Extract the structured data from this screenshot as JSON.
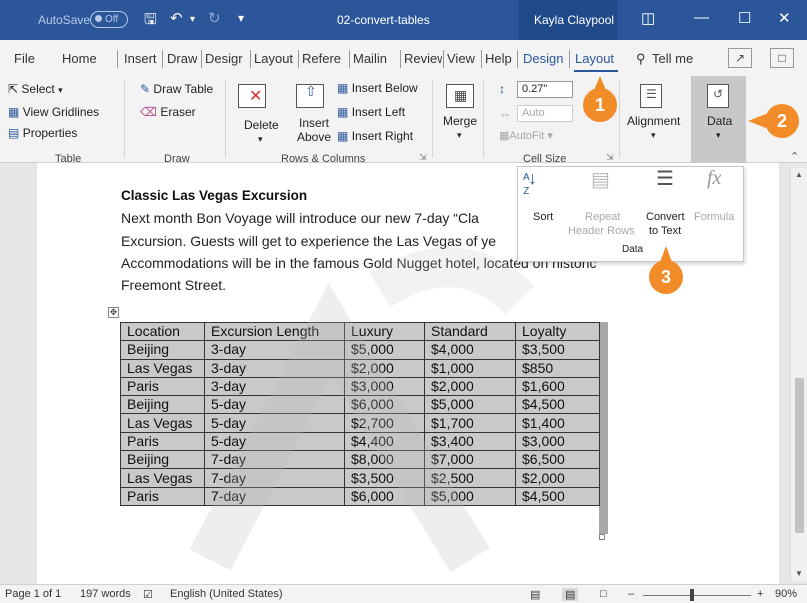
{
  "titlebar": {
    "autosave_label": "AutoSave",
    "autosave_state": "Off",
    "document_title": "02-convert-tables",
    "user_name": "Kayla Claypool",
    "controls": [
      "ribbon-display-icon",
      "minimize-icon",
      "maximize-icon",
      "close-icon"
    ]
  },
  "tabs": {
    "items": [
      "File",
      "Home",
      "Insert",
      "Draw",
      "Desigr",
      "Layout",
      "Refere",
      "Mailin",
      "Review",
      "View",
      "Help",
      "Design",
      "Layout"
    ],
    "tell_me": "Tell me"
  },
  "ribbon": {
    "table_group": {
      "label": "Table",
      "select": "Select",
      "view_gridlines": "View Gridlines",
      "properties": "Properties"
    },
    "draw_group": {
      "label": "Draw",
      "draw_table": "Draw Table",
      "eraser": "Eraser"
    },
    "rows_cols_group": {
      "label": "Rows & Columns",
      "delete": "Delete",
      "insert_above_1": "Insert",
      "insert_above_2": "Above",
      "insert_below": "Insert Below",
      "insert_left": "Insert Left",
      "insert_right": "Insert Right"
    },
    "merge_group": {
      "merge": "Merge"
    },
    "cell_size_group": {
      "label": "Cell Size",
      "height_value": "0.27\"",
      "width_value": "Auto",
      "autofit": "AutoFit"
    },
    "alignment": "Alignment",
    "data": "Data"
  },
  "data_popup": {
    "sort": "Sort",
    "repeat_1": "Repeat",
    "repeat_2": "Header Rows",
    "convert_1": "Convert",
    "convert_2": "to Text",
    "formula": "Formula",
    "group_label": "Data"
  },
  "callouts": [
    "1",
    "2",
    "3"
  ],
  "document": {
    "heading": "Classic Las Vegas Excursion",
    "lines": [
      "Next month Bon Voyage will introduce our new 7-day “Cla",
      "Excursion. Guests will get to experience the Las Vegas of ye",
      "Accommodations will be in the famous Gold Nugget hotel, located on historic",
      "Freemont Street."
    ],
    "table": {
      "headers": [
        "Location",
        "Excursion Length",
        "Luxury",
        "Standard",
        "Loyalty"
      ],
      "rows": [
        [
          "Beijing",
          "3-day",
          "$5,000",
          "$4,000",
          "$3,500"
        ],
        [
          "Las Vegas",
          "3-day",
          "$2,000",
          "$1,000",
          "$850"
        ],
        [
          "Paris",
          "3-day",
          "$3,000",
          "$2,000",
          "$1,600"
        ],
        [
          "Beijing",
          "5-day",
          "$6,000",
          "$5,000",
          "$4,500"
        ],
        [
          "Las Vegas",
          "5-day",
          "$2,700",
          "$1,700",
          "$1,400"
        ],
        [
          "Paris",
          "5-day",
          "$4,400",
          "$3,400",
          "$3,000"
        ],
        [
          "Beijing",
          "7-day",
          "$8,000",
          "$7,000",
          "$6,500"
        ],
        [
          "Las Vegas",
          "7-day",
          "$3,500",
          "$2,500",
          "$2,000"
        ],
        [
          "Paris",
          "7-day",
          "$6,000",
          "$5,000",
          "$4,500"
        ]
      ]
    }
  },
  "statusbar": {
    "page": "Page 1 of 1",
    "words": "197 words",
    "language": "English (United States)",
    "zoom": "90%"
  },
  "colors": {
    "brand": "#2b579a",
    "callout": "#f28c28",
    "selection": "#c9c9c9"
  }
}
